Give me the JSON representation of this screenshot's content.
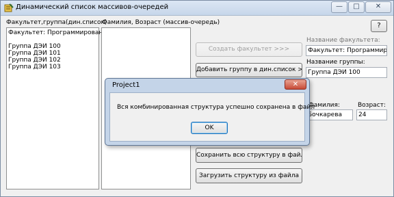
{
  "window": {
    "title": "Динамический список массивов-очередей",
    "minimize": "—",
    "maximize": "□",
    "close": "✕"
  },
  "help_button": "?",
  "left_panel": {
    "label": "Факультет,группа(дин.список)",
    "items": [
      "Факультет: Программирование",
      "",
      "Группа ДЭИ 100",
      "Группа ДЭИ 101",
      "Группа ДЭИ 102",
      "Группа ДЭИ 103"
    ]
  },
  "middle_panel": {
    "label": "Фамилия, Возраст (массив-очередь)",
    "items": []
  },
  "buttons": {
    "create_faculty": "Создать факультет >>>",
    "add_group": "Добавить группу в дин.список >>>",
    "save_structure": "Сохранить всю структуру в файл",
    "load_structure": "Загрузить структуру из файла"
  },
  "fields": {
    "faculty_name_label": "Название факультета:",
    "faculty_name_value": "Факультет: Программирова",
    "group_name_label": "Название группы:",
    "group_name_value": "Группа ДЭИ 100",
    "surname_label": "Фамилия:",
    "surname_value": "Бочкарева",
    "age_label": "Возраст:",
    "age_value": "24"
  },
  "dialog": {
    "title": "Project1",
    "close": "✕",
    "message": "Вся комбинированная структура успешно сохранена в файл",
    "ok": "OK"
  }
}
